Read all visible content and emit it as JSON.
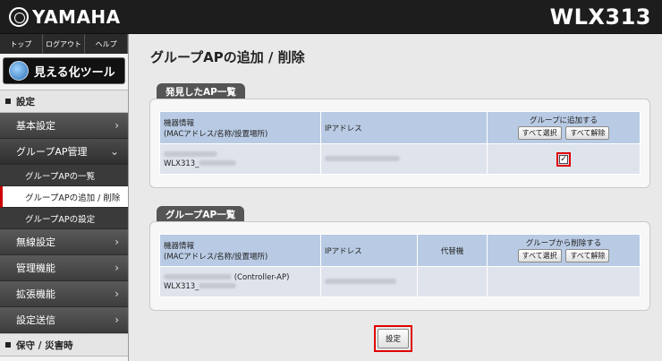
{
  "header": {
    "brand": "YAMAHA",
    "model": "WLX313"
  },
  "sidebar": {
    "topnav": [
      "トップ",
      "ログアウト",
      "ヘルプ"
    ],
    "vis_tool": "見える化ツール",
    "section_settings": "設定",
    "items": [
      {
        "label": "基本設定"
      },
      {
        "label": "グループAP管理"
      },
      {
        "label": "無線設定"
      },
      {
        "label": "管理機能"
      },
      {
        "label": "拡張機能"
      },
      {
        "label": "設定送信"
      }
    ],
    "subitems": [
      "グループAPの一覧",
      "グループAPの追加 / 削除",
      "グループAPの設定"
    ],
    "section_maint": "保守 / 災害時"
  },
  "main": {
    "title": "グループAPの追加 / 削除",
    "found": {
      "tab": "発見したAP一覧",
      "col_device_line1": "機器情報",
      "col_device_line2": "(MACアドレス/名称/設置場所)",
      "col_ip": "IPアドレス",
      "col_add": "グループに追加する",
      "btn_select_all": "すべて選択",
      "btn_clear_all": "すべて解除",
      "row_name": "WLX313_",
      "checked_mark": "✓"
    },
    "group": {
      "tab": "グループAP一覧",
      "col_device_line1": "機器情報",
      "col_device_line2": "(MACアドレス/名称/設置場所)",
      "col_ip": "IPアドレス",
      "col_backup": "代替機",
      "col_remove": "グループから削除する",
      "btn_select_all": "すべて選択",
      "btn_clear_all": "すべて解除",
      "row_role": "(Controller-AP)",
      "row_name": "WLX313_"
    },
    "submit": "設定"
  }
}
